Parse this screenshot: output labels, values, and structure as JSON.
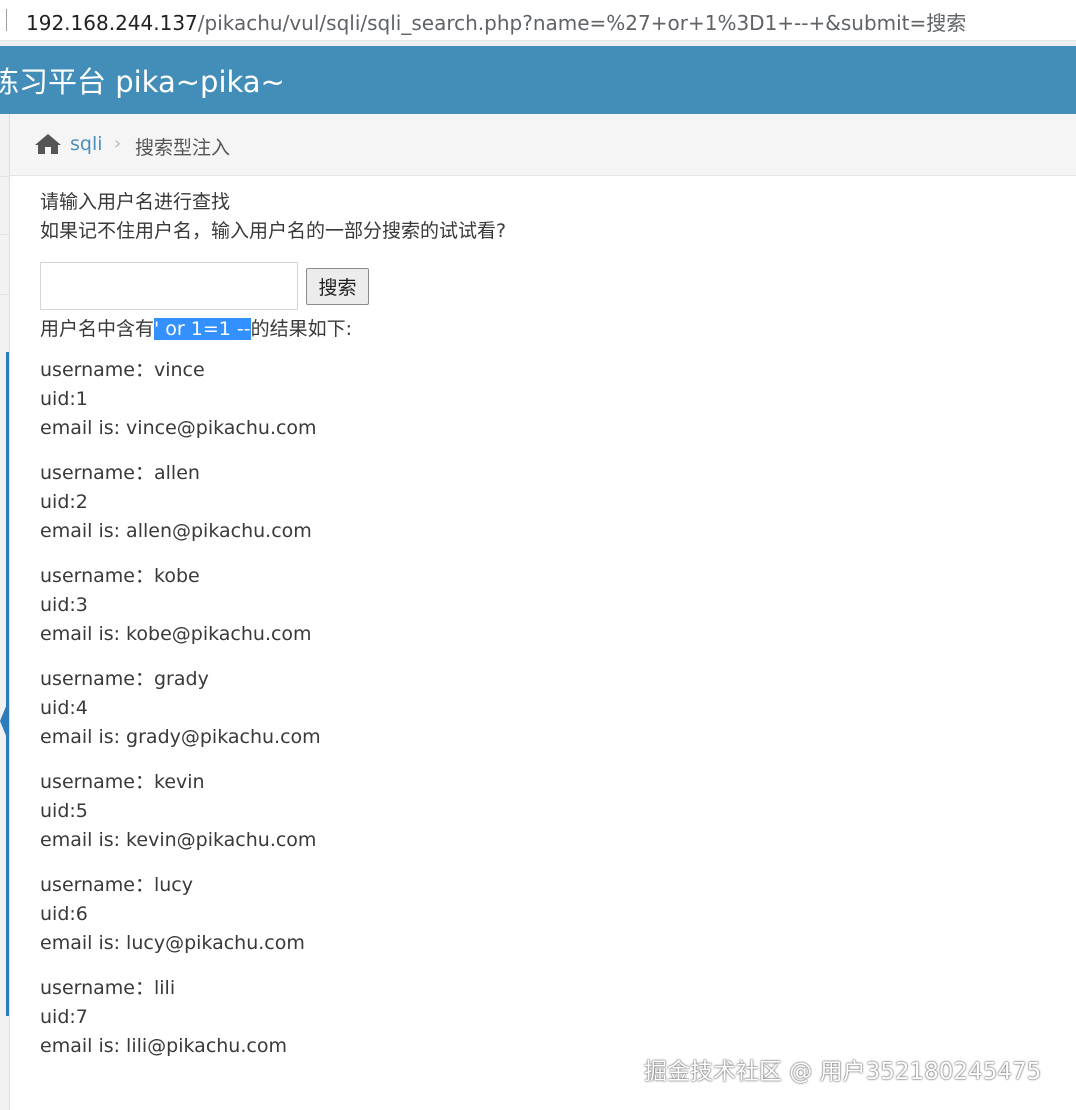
{
  "browser": {
    "url_host": "192.168.244.137",
    "url_rest": "/pikachu/vul/sqli/sqli_search.php?name=%27+or+1%3D1+--+&submit=搜索"
  },
  "header": {
    "title": "练习平台 pika~pika~"
  },
  "breadcrumb": {
    "link": "sqli",
    "separator": "›",
    "current": "搜索型注入"
  },
  "search": {
    "hint_line1": "请输入用户名进行查找",
    "hint_line2": "如果记不住用户名，输入用户名的一部分搜索的试试看?",
    "input_value": "",
    "button_label": "搜索"
  },
  "result": {
    "prefix": "用户名中含有",
    "query": "' or 1=1 --",
    "suffix": "的结果如下:"
  },
  "records": [
    {
      "username": "username：vince",
      "uid": "uid:1",
      "email": "email is: vince@pikachu.com"
    },
    {
      "username": "username：allen",
      "uid": "uid:2",
      "email": "email is: allen@pikachu.com"
    },
    {
      "username": "username：kobe",
      "uid": "uid:3",
      "email": "email is: kobe@pikachu.com"
    },
    {
      "username": "username：grady",
      "uid": "uid:4",
      "email": "email is: grady@pikachu.com"
    },
    {
      "username": "username：kevin",
      "uid": "uid:5",
      "email": "email is: kevin@pikachu.com"
    },
    {
      "username": "username：lucy",
      "uid": "uid:6",
      "email": "email is: lucy@pikachu.com"
    },
    {
      "username": "username：lili",
      "uid": "uid:7",
      "email": "email is: lili@pikachu.com"
    }
  ],
  "watermark": "掘金技术社区 @ 用户352180245475",
  "colors": {
    "header": "#438eb9",
    "link": "#4c8fbd",
    "selection": "#3390ff"
  }
}
